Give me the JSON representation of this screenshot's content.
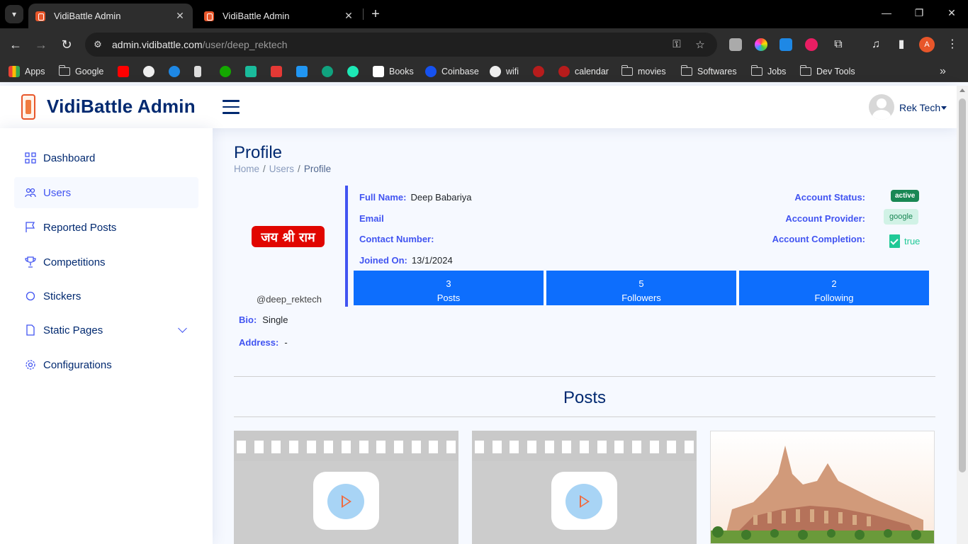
{
  "browser": {
    "tabs": [
      {
        "title": "VidiBattle Admin",
        "active": true
      },
      {
        "title": "VidiBattle Admin",
        "active": false
      }
    ],
    "url_host": "admin.vidibattle.com",
    "url_path": "/user/deep_rektech",
    "profile_initial": "A",
    "bookmarks": [
      "Apps",
      "Google",
      "Books",
      "Coinbase",
      "wifi",
      "calendar",
      "movies",
      "Softwares",
      "Jobs",
      "Dev Tools"
    ]
  },
  "header": {
    "logo_text": "VidiBattle Admin",
    "user_name": "Rek Tech"
  },
  "sidebar": {
    "items": [
      {
        "label": "Dashboard",
        "icon": "grid-icon"
      },
      {
        "label": "Users",
        "icon": "people-icon"
      },
      {
        "label": "Reported Posts",
        "icon": "flag-icon"
      },
      {
        "label": "Competitions",
        "icon": "trophy-icon"
      },
      {
        "label": "Stickers",
        "icon": "circle-icon"
      },
      {
        "label": "Static Pages",
        "icon": "file-icon"
      },
      {
        "label": "Configurations",
        "icon": "gear-icon"
      }
    ]
  },
  "main": {
    "page_title": "Profile",
    "breadcrumb": [
      "Home",
      "Users",
      "Profile"
    ],
    "profile": {
      "image_text": "जय श्री राम",
      "handle": "@deep_rektech",
      "bio_label": "Bio:",
      "bio": "Single",
      "address_label": "Address:",
      "address": "-",
      "full_name_label": "Full Name:",
      "full_name": "Deep Babariya",
      "email_label": "Email",
      "email": "",
      "contact_label": "Contact Number:",
      "contact": "",
      "joined_label": "Joined On:",
      "joined": "13/1/2024",
      "account_status_label": "Account Status:",
      "account_status": "active",
      "account_provider_label": "Account Provider:",
      "account_provider": "google",
      "account_completion_label": "Account Completion:",
      "account_completion": "true"
    },
    "stats": [
      {
        "value": "3",
        "label": "Posts"
      },
      {
        "value": "5",
        "label": "Followers"
      },
      {
        "value": "2",
        "label": "Following"
      }
    ],
    "posts_title": "Posts"
  },
  "colors": {
    "primary_dark": "#012970",
    "accent": "#4154f1",
    "stat_blue": "#0d6efd",
    "success": "#198754"
  }
}
